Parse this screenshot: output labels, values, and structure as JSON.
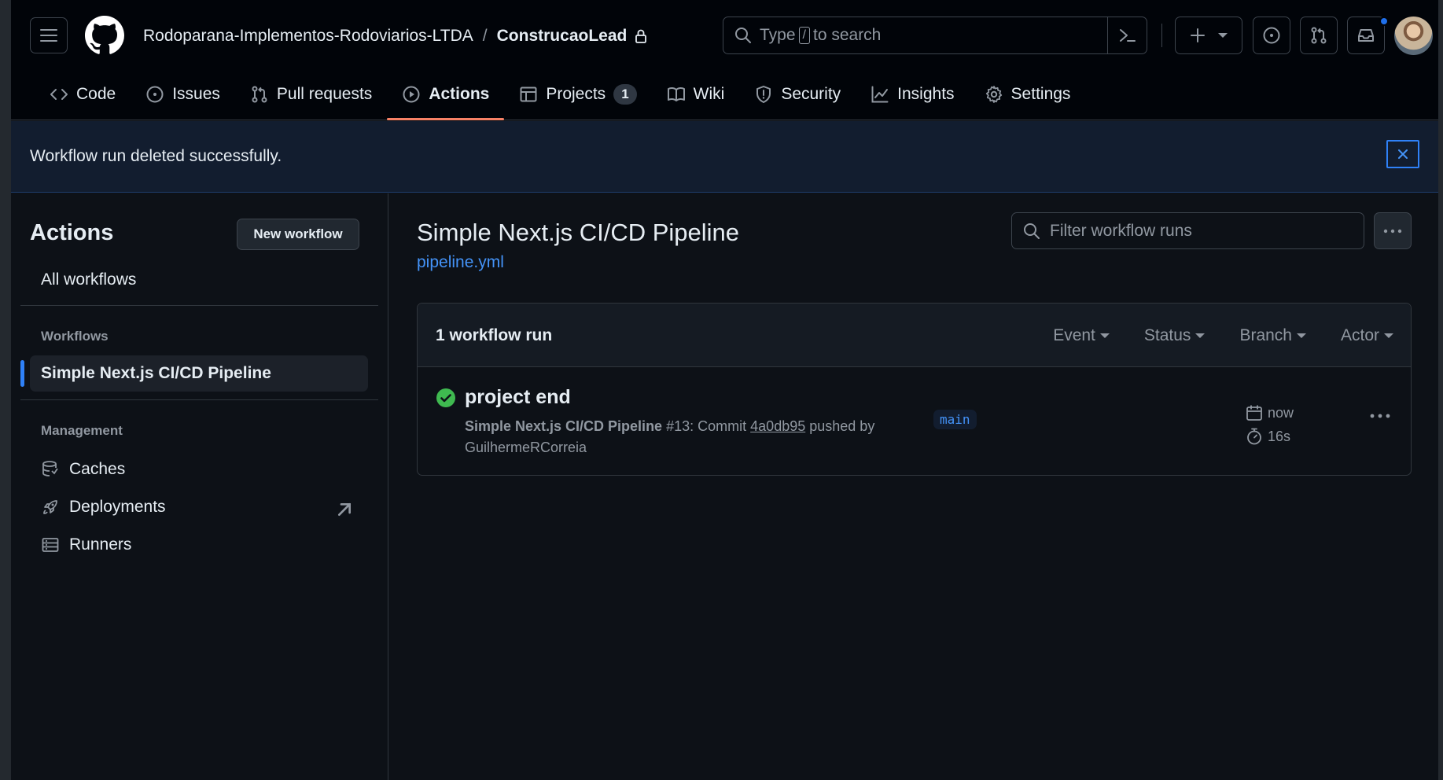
{
  "header": {
    "owner": "Rodoparana-Implementos-Rodoviarios-LTDA",
    "separator": "/",
    "repo": "ConstrucaoLead",
    "search_prefix": "Type",
    "search_key": "/",
    "search_suffix": "to search"
  },
  "tabs": [
    {
      "label": "Code",
      "icon": "code-icon"
    },
    {
      "label": "Issues",
      "icon": "issue-opened-icon"
    },
    {
      "label": "Pull requests",
      "icon": "git-pull-request-icon"
    },
    {
      "label": "Actions",
      "icon": "play-icon",
      "active": true
    },
    {
      "label": "Projects",
      "icon": "table-icon",
      "counter": "1"
    },
    {
      "label": "Wiki",
      "icon": "book-icon"
    },
    {
      "label": "Security",
      "icon": "shield-icon"
    },
    {
      "label": "Insights",
      "icon": "graph-icon"
    },
    {
      "label": "Settings",
      "icon": "gear-icon"
    }
  ],
  "flash": {
    "message": "Workflow run deleted successfully."
  },
  "sidebar": {
    "title": "Actions",
    "new_workflow": "New workflow",
    "all_workflows": "All workflows",
    "workflows_heading": "Workflows",
    "selected_workflow": "Simple Next.js CI/CD Pipeline",
    "management_heading": "Management",
    "management_items": [
      "Caches",
      "Deployments",
      "Runners"
    ]
  },
  "main": {
    "title": "Simple Next.js CI/CD Pipeline",
    "file_link": "pipeline.yml",
    "filter_placeholder": "Filter workflow runs",
    "runs_count": "1 workflow run",
    "filters": [
      "Event",
      "Status",
      "Branch",
      "Actor"
    ],
    "run": {
      "title": "project end",
      "workflow": "Simple Next.js CI/CD Pipeline",
      "number": "#13: Commit",
      "sha": "4a0db95",
      "pushed_by": "pushed by",
      "actor": "GuilhermeRCorreia",
      "branch": "main",
      "when": "now",
      "duration": "16s",
      "status": "success"
    }
  },
  "colors": {
    "accent": "#2f81f7",
    "success": "#3fb950",
    "tab_underline": "#f78166",
    "link": "#4493f8"
  }
}
